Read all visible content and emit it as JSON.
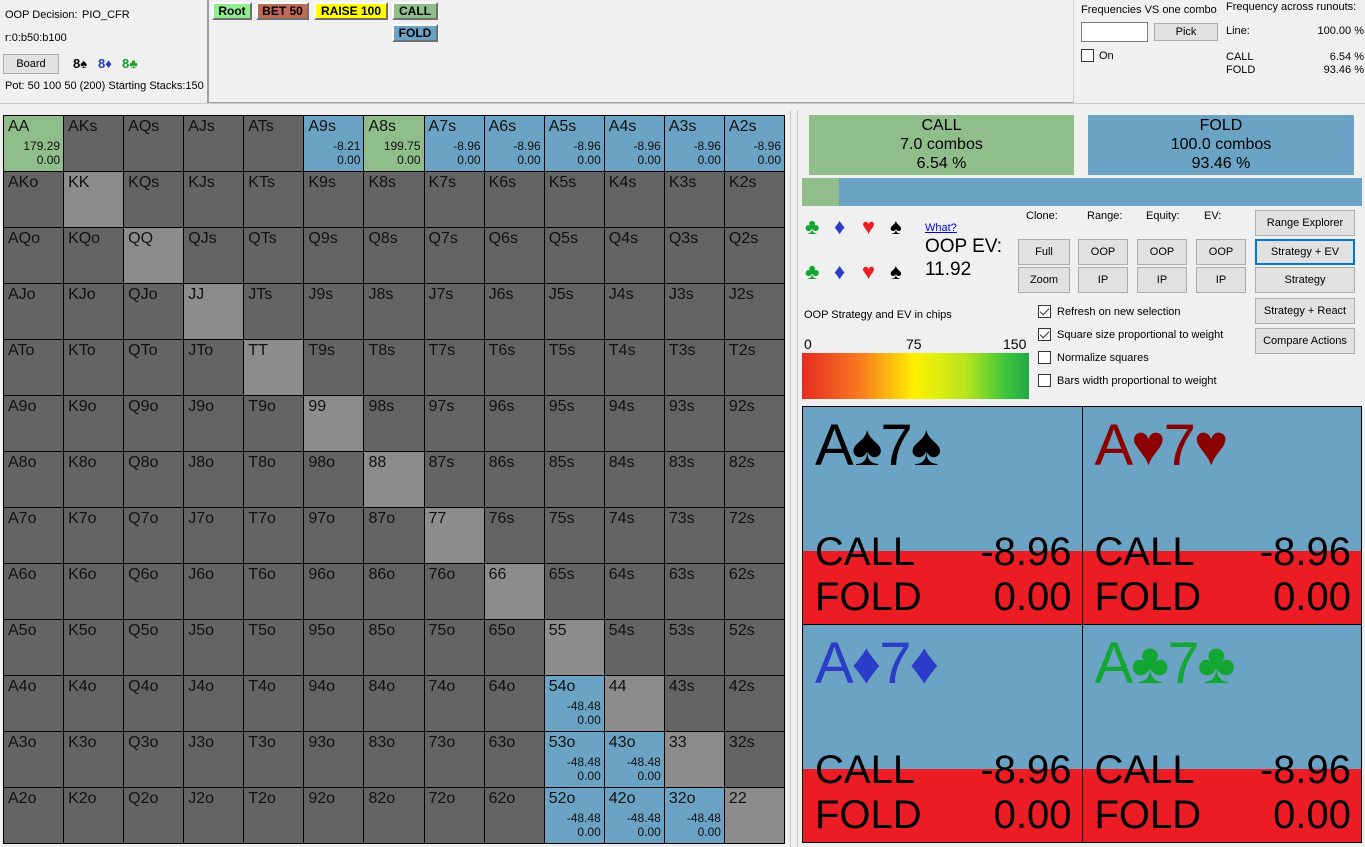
{
  "info": {
    "decision_label": "OOP Decision:",
    "algorithm": "PIO_CFR",
    "line": "r:0:b50:b100",
    "board_button": "Board",
    "board_cards": [
      {
        "text": "8♠",
        "color": "#000000"
      },
      {
        "text": "8♦",
        "color": "#2a3cc8"
      },
      {
        "text": "8♣",
        "color": "#1a9e2a"
      }
    ],
    "pot_text": "Pot: 50 100 50 (200) Starting Stacks:150"
  },
  "tree": {
    "nodes": [
      {
        "label": "Root",
        "color": "#90ee90"
      },
      {
        "label": "BET 50",
        "color": "#c06a58"
      },
      {
        "label": "RAISE 100",
        "color": "#ffff00"
      },
      {
        "label": "CALL",
        "color": "#8fbe8b"
      },
      {
        "label": "FOLD",
        "color": "#6ba3c4"
      }
    ]
  },
  "combo_freq": {
    "title": "Frequencies VS one combo",
    "input_value": "",
    "pick_button": "Pick",
    "on_label": "On",
    "on_checked": false
  },
  "runouts": {
    "title": "Frequency across runouts:",
    "line_label": "Line:",
    "line_value": "100.00 %",
    "rows": [
      {
        "label": "CALL",
        "value": "6.54 %"
      },
      {
        "label": "FOLD",
        "value": "93.46 %"
      }
    ]
  },
  "grid": {
    "rows": [
      [
        "AA",
        "AKs",
        "AQs",
        "AJs",
        "ATs",
        "A9s",
        "A8s",
        "A7s",
        "A6s",
        "A5s",
        "A4s",
        "A3s",
        "A2s"
      ],
      [
        "AKo",
        "KK",
        "KQs",
        "KJs",
        "KTs",
        "K9s",
        "K8s",
        "K7s",
        "K6s",
        "K5s",
        "K4s",
        "K3s",
        "K2s"
      ],
      [
        "AQo",
        "KQo",
        "QQ",
        "QJs",
        "QTs",
        "Q9s",
        "Q8s",
        "Q7s",
        "Q6s",
        "Q5s",
        "Q4s",
        "Q3s",
        "Q2s"
      ],
      [
        "AJo",
        "KJo",
        "QJo",
        "JJ",
        "JTs",
        "J9s",
        "J8s",
        "J7s",
        "J6s",
        "J5s",
        "J4s",
        "J3s",
        "J2s"
      ],
      [
        "ATo",
        "KTo",
        "QTo",
        "JTo",
        "TT",
        "T9s",
        "T8s",
        "T7s",
        "T6s",
        "T5s",
        "T4s",
        "T3s",
        "T2s"
      ],
      [
        "A9o",
        "K9o",
        "Q9o",
        "J9o",
        "T9o",
        "99",
        "98s",
        "97s",
        "96s",
        "95s",
        "94s",
        "93s",
        "92s"
      ],
      [
        "A8o",
        "K8o",
        "Q8o",
        "J8o",
        "T8o",
        "98o",
        "88",
        "87s",
        "86s",
        "85s",
        "84s",
        "83s",
        "82s"
      ],
      [
        "A7o",
        "K7o",
        "Q7o",
        "J7o",
        "T7o",
        "97o",
        "87o",
        "77",
        "76s",
        "75s",
        "74s",
        "73s",
        "72s"
      ],
      [
        "A6o",
        "K6o",
        "Q6o",
        "J6o",
        "T6o",
        "96o",
        "86o",
        "76o",
        "66",
        "65s",
        "64s",
        "63s",
        "62s"
      ],
      [
        "A5o",
        "K5o",
        "Q5o",
        "J5o",
        "T5o",
        "95o",
        "85o",
        "75o",
        "65o",
        "55",
        "54s",
        "53s",
        "52s"
      ],
      [
        "A4o",
        "K4o",
        "Q4o",
        "J4o",
        "T4o",
        "94o",
        "84o",
        "74o",
        "64o",
        "54o",
        "44",
        "43s",
        "42s"
      ],
      [
        "A3o",
        "K3o",
        "Q3o",
        "J3o",
        "T3o",
        "93o",
        "83o",
        "73o",
        "63o",
        "53o",
        "43o",
        "33",
        "32s"
      ],
      [
        "A2o",
        "K2o",
        "Q2o",
        "J2o",
        "T2o",
        "92o",
        "82o",
        "72o",
        "62o",
        "52o",
        "42o",
        "32o",
        "22"
      ]
    ],
    "active": {
      "AA": {
        "action": "call",
        "ev_call": "179.29",
        "ev_fold": "0.00"
      },
      "A9s": {
        "action": "fold",
        "ev_call": "-8.21",
        "ev_fold": "0.00"
      },
      "A8s": {
        "action": "call",
        "ev_call": "199.75",
        "ev_fold": "0.00"
      },
      "A7s": {
        "action": "fold",
        "ev_call": "-8.96",
        "ev_fold": "0.00"
      },
      "A6s": {
        "action": "fold",
        "ev_call": "-8.96",
        "ev_fold": "0.00"
      },
      "A5s": {
        "action": "fold",
        "ev_call": "-8.96",
        "ev_fold": "0.00"
      },
      "A4s": {
        "action": "fold",
        "ev_call": "-8.96",
        "ev_fold": "0.00"
      },
      "A3s": {
        "action": "fold",
        "ev_call": "-8.96",
        "ev_fold": "0.00"
      },
      "A2s": {
        "action": "fold",
        "ev_call": "-8.96",
        "ev_fold": "0.00"
      },
      "54o": {
        "action": "fold",
        "ev_call": "-48.48",
        "ev_fold": "0.00"
      },
      "53o": {
        "action": "fold",
        "ev_call": "-48.48",
        "ev_fold": "0.00"
      },
      "43o": {
        "action": "fold",
        "ev_call": "-48.48",
        "ev_fold": "0.00"
      },
      "52o": {
        "action": "fold",
        "ev_call": "-48.48",
        "ev_fold": "0.00"
      },
      "42o": {
        "action": "fold",
        "ev_call": "-48.48",
        "ev_fold": "0.00"
      },
      "32o": {
        "action": "fold",
        "ev_call": "-48.48",
        "ev_fold": "0.00"
      }
    }
  },
  "summary": {
    "actions": [
      {
        "name": "CALL",
        "combos": "7.0 combos",
        "percent": "6.54 %",
        "color": "#8fbe8b",
        "fraction": 0.0654
      },
      {
        "name": "FOLD",
        "combos": "100.0 combos",
        "percent": "93.46 %",
        "color": "#6ba3c4",
        "fraction": 0.9346
      }
    ]
  },
  "controls": {
    "what_link": "What?",
    "ev_label": "OOP EV:",
    "ev_value": "11.92",
    "clone_label": "Clone:",
    "range_label": "Range:",
    "equity_label": "Equity:",
    "ev_col_label": "EV:",
    "full_button": "Full",
    "zoom_button": "Zoom",
    "oop_button": "OOP",
    "ip_button": "IP",
    "range_explorer": "Range Explorer",
    "strategy_ev": "Strategy + EV",
    "strategy": "Strategy",
    "strategy_react": "Strategy + React",
    "compare_actions": "Compare Actions",
    "scale_title": "OOP Strategy and EV in chips",
    "scale_min": "0",
    "scale_mid": "75",
    "scale_max": "150",
    "options": [
      {
        "label": "Refresh on new selection",
        "checked": true
      },
      {
        "label": "Square size proportional to weight",
        "checked": true
      },
      {
        "label": "Normalize squares",
        "checked": false
      },
      {
        "label": "Bars width proportional to weight",
        "checked": false
      }
    ]
  },
  "combos": [
    {
      "rank1": "A",
      "rank2": "7",
      "suit": "♠",
      "color": "#000000",
      "call_label": "CALL",
      "call_ev": "-8.96",
      "fold_label": "FOLD",
      "fold_ev": "0.00"
    },
    {
      "rank1": "A",
      "rank2": "7",
      "suit": "♥",
      "color": "#8b0000",
      "call_label": "CALL",
      "call_ev": "-8.96",
      "fold_label": "FOLD",
      "fold_ev": "0.00"
    },
    {
      "rank1": "A",
      "rank2": "7",
      "suit": "♦",
      "color": "#2a3cc8",
      "call_label": "CALL",
      "call_ev": "-8.96",
      "fold_label": "FOLD",
      "fold_ev": "0.00"
    },
    {
      "rank1": "A",
      "rank2": "7",
      "suit": "♣",
      "color": "#13a632",
      "call_label": "CALL",
      "call_ev": "-8.96",
      "fold_label": "FOLD",
      "fold_ev": "0.00"
    }
  ]
}
